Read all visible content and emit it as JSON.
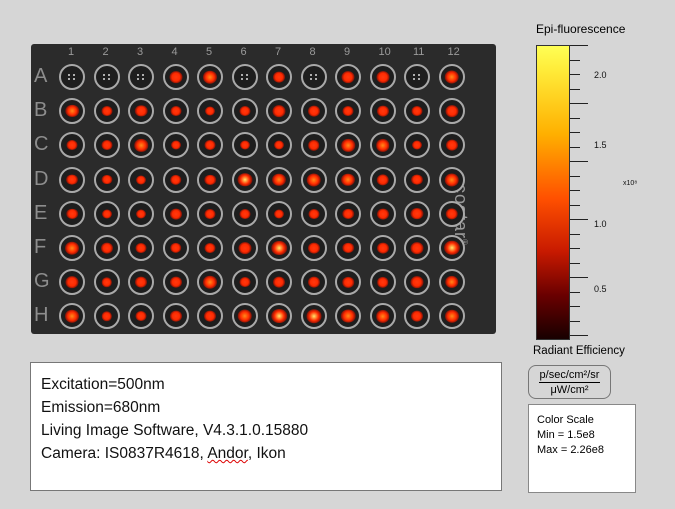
{
  "plate": {
    "columns": [
      "1",
      "2",
      "3",
      "4",
      "5",
      "6",
      "7",
      "8",
      "9",
      "10",
      "11",
      "12"
    ],
    "rows": [
      "A",
      "B",
      "C",
      "D",
      "E",
      "F",
      "G",
      "H"
    ],
    "brand": "costar",
    "brand_suffix": "®"
  },
  "scale": {
    "title": "Epi-fluorescence",
    "tick_labels": [
      "2.0",
      "1.5",
      "1.0",
      "0.5"
    ],
    "exponent": "x10⁸",
    "radiant_label": "Radiant Efficiency",
    "unit_top": "p/sec/cm²/sr",
    "unit_bottom": "μW/cm²",
    "colors": {
      "high": "#ffff55",
      "mid": "#ff5000",
      "low": "#180000"
    }
  },
  "color_scale": {
    "title": "Color Scale",
    "min": "Min = 1.5e8",
    "max": "Max = 2.26e8"
  },
  "info": {
    "excitation": "Excitation=500nm",
    "emission": "Emission=680nm",
    "software": "Living Image Software, V4.3.1.0.15880",
    "camera_prefix": "Camera: IS0837R4618, ",
    "camera_mid": "Andor",
    "camera_suffix": ", Ikon"
  },
  "spots": [
    [
      0,
      0,
      0,
      0.7,
      0.8,
      0,
      0.6,
      0,
      0.7,
      0.7,
      0,
      0.85
    ],
    [
      0.75,
      0.5,
      0.65,
      0.5,
      0.4,
      0.5,
      0.7,
      0.6,
      0.5,
      0.6,
      0.5,
      0.7
    ],
    [
      0.5,
      0.5,
      0.75,
      0.4,
      0.5,
      0.4,
      0.4,
      0.55,
      0.75,
      0.75,
      0.4,
      0.6
    ],
    [
      0.6,
      0.5,
      0.4,
      0.55,
      0.55,
      0.9,
      0.8,
      0.85,
      0.8,
      0.65,
      0.6,
      0.85
    ],
    [
      0.55,
      0.4,
      0.4,
      0.6,
      0.5,
      0.5,
      0.4,
      0.5,
      0.55,
      0.6,
      0.7,
      0.65
    ],
    [
      0.8,
      0.6,
      0.5,
      0.55,
      0.5,
      0.7,
      0.95,
      0.6,
      0.55,
      0.6,
      0.7,
      1.0
    ],
    [
      0.7,
      0.45,
      0.6,
      0.6,
      0.8,
      0.5,
      0.6,
      0.6,
      0.55,
      0.55,
      0.7,
      0.75
    ],
    [
      0.8,
      0.45,
      0.5,
      0.6,
      0.6,
      0.85,
      0.95,
      0.9,
      0.85,
      0.75,
      0.6,
      0.8
    ]
  ]
}
